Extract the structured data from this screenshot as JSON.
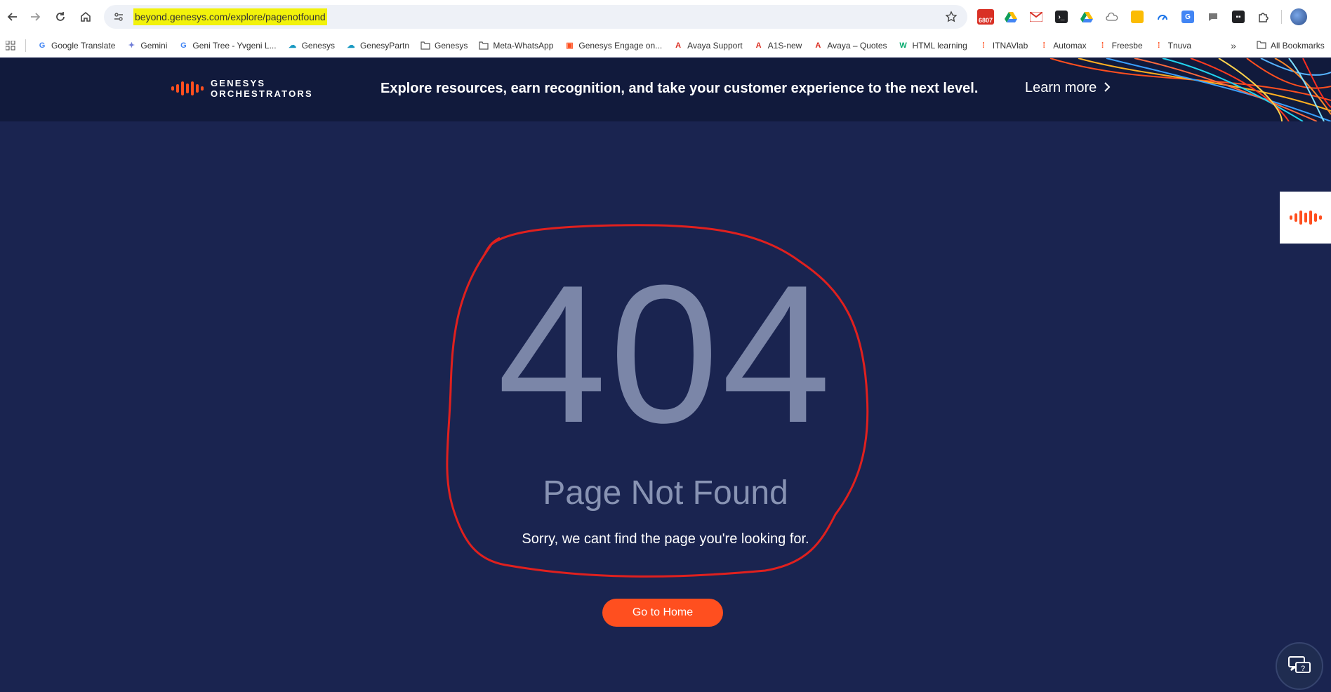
{
  "browser": {
    "url": "beyond.genesys.com/explore/pagenotfound",
    "calendar_badge": "6807",
    "bookmarks": [
      {
        "label": "Google Translate",
        "icon": "translate-icon",
        "color": "#4285f4"
      },
      {
        "label": "Gemini",
        "icon": "gemini-icon",
        "color": "#6f7dd8"
      },
      {
        "label": "Geni Tree - Yvgeni L...",
        "icon": "google-g-icon",
        "color": "#4285f4"
      },
      {
        "label": "Genesys",
        "icon": "salesforce-cloud-icon",
        "color": "#1798c1"
      },
      {
        "label": "GenesyPartn",
        "icon": "salesforce-cloud-icon",
        "color": "#1798c1"
      },
      {
        "label": "Genesys",
        "icon": "folder-icon",
        "color": "#555555"
      },
      {
        "label": "Meta-WhatsApp",
        "icon": "folder-icon",
        "color": "#555555"
      },
      {
        "label": "Genesys Engage on...",
        "icon": "genesys-engage-icon",
        "color": "#ff4f1f"
      },
      {
        "label": "Avaya Support",
        "icon": "avaya-icon",
        "color": "#da291c"
      },
      {
        "label": "A1S-new",
        "icon": "avaya-icon",
        "color": "#da291c"
      },
      {
        "label": "Avaya – Quotes",
        "icon": "avaya-icon",
        "color": "#da291c"
      },
      {
        "label": "HTML learning",
        "icon": "w3-icon",
        "color": "#04aa6d"
      },
      {
        "label": "ITNAVlab",
        "icon": "genesys-bars-icon",
        "color": "#ff4f1f"
      },
      {
        "label": "Automax",
        "icon": "genesys-bars-icon",
        "color": "#ff4f1f"
      },
      {
        "label": "Freesbe",
        "icon": "genesys-bars-icon",
        "color": "#ff4f1f"
      },
      {
        "label": "Tnuva",
        "icon": "genesys-bars-icon",
        "color": "#ff4f1f"
      }
    ],
    "all_bookmarks_label": "All Bookmarks",
    "more_label": "»"
  },
  "banner": {
    "logo_line1": "GENESYS",
    "logo_line2": "ORCHESTRATORS",
    "message": "Explore resources, earn recognition, and take your customer experience to the next level.",
    "learn_more_label": "Learn more"
  },
  "error": {
    "code": "404",
    "title": "Page Not Found",
    "message": "Sorry, we cant find the page you're looking for.",
    "home_button": "Go to Home"
  },
  "colors": {
    "accent": "#ff4f1f",
    "page_bg": "#1a2450",
    "banner_bg": "#111a3c",
    "annotation": "#e0201e",
    "url_highlight": "#f2f20b"
  }
}
